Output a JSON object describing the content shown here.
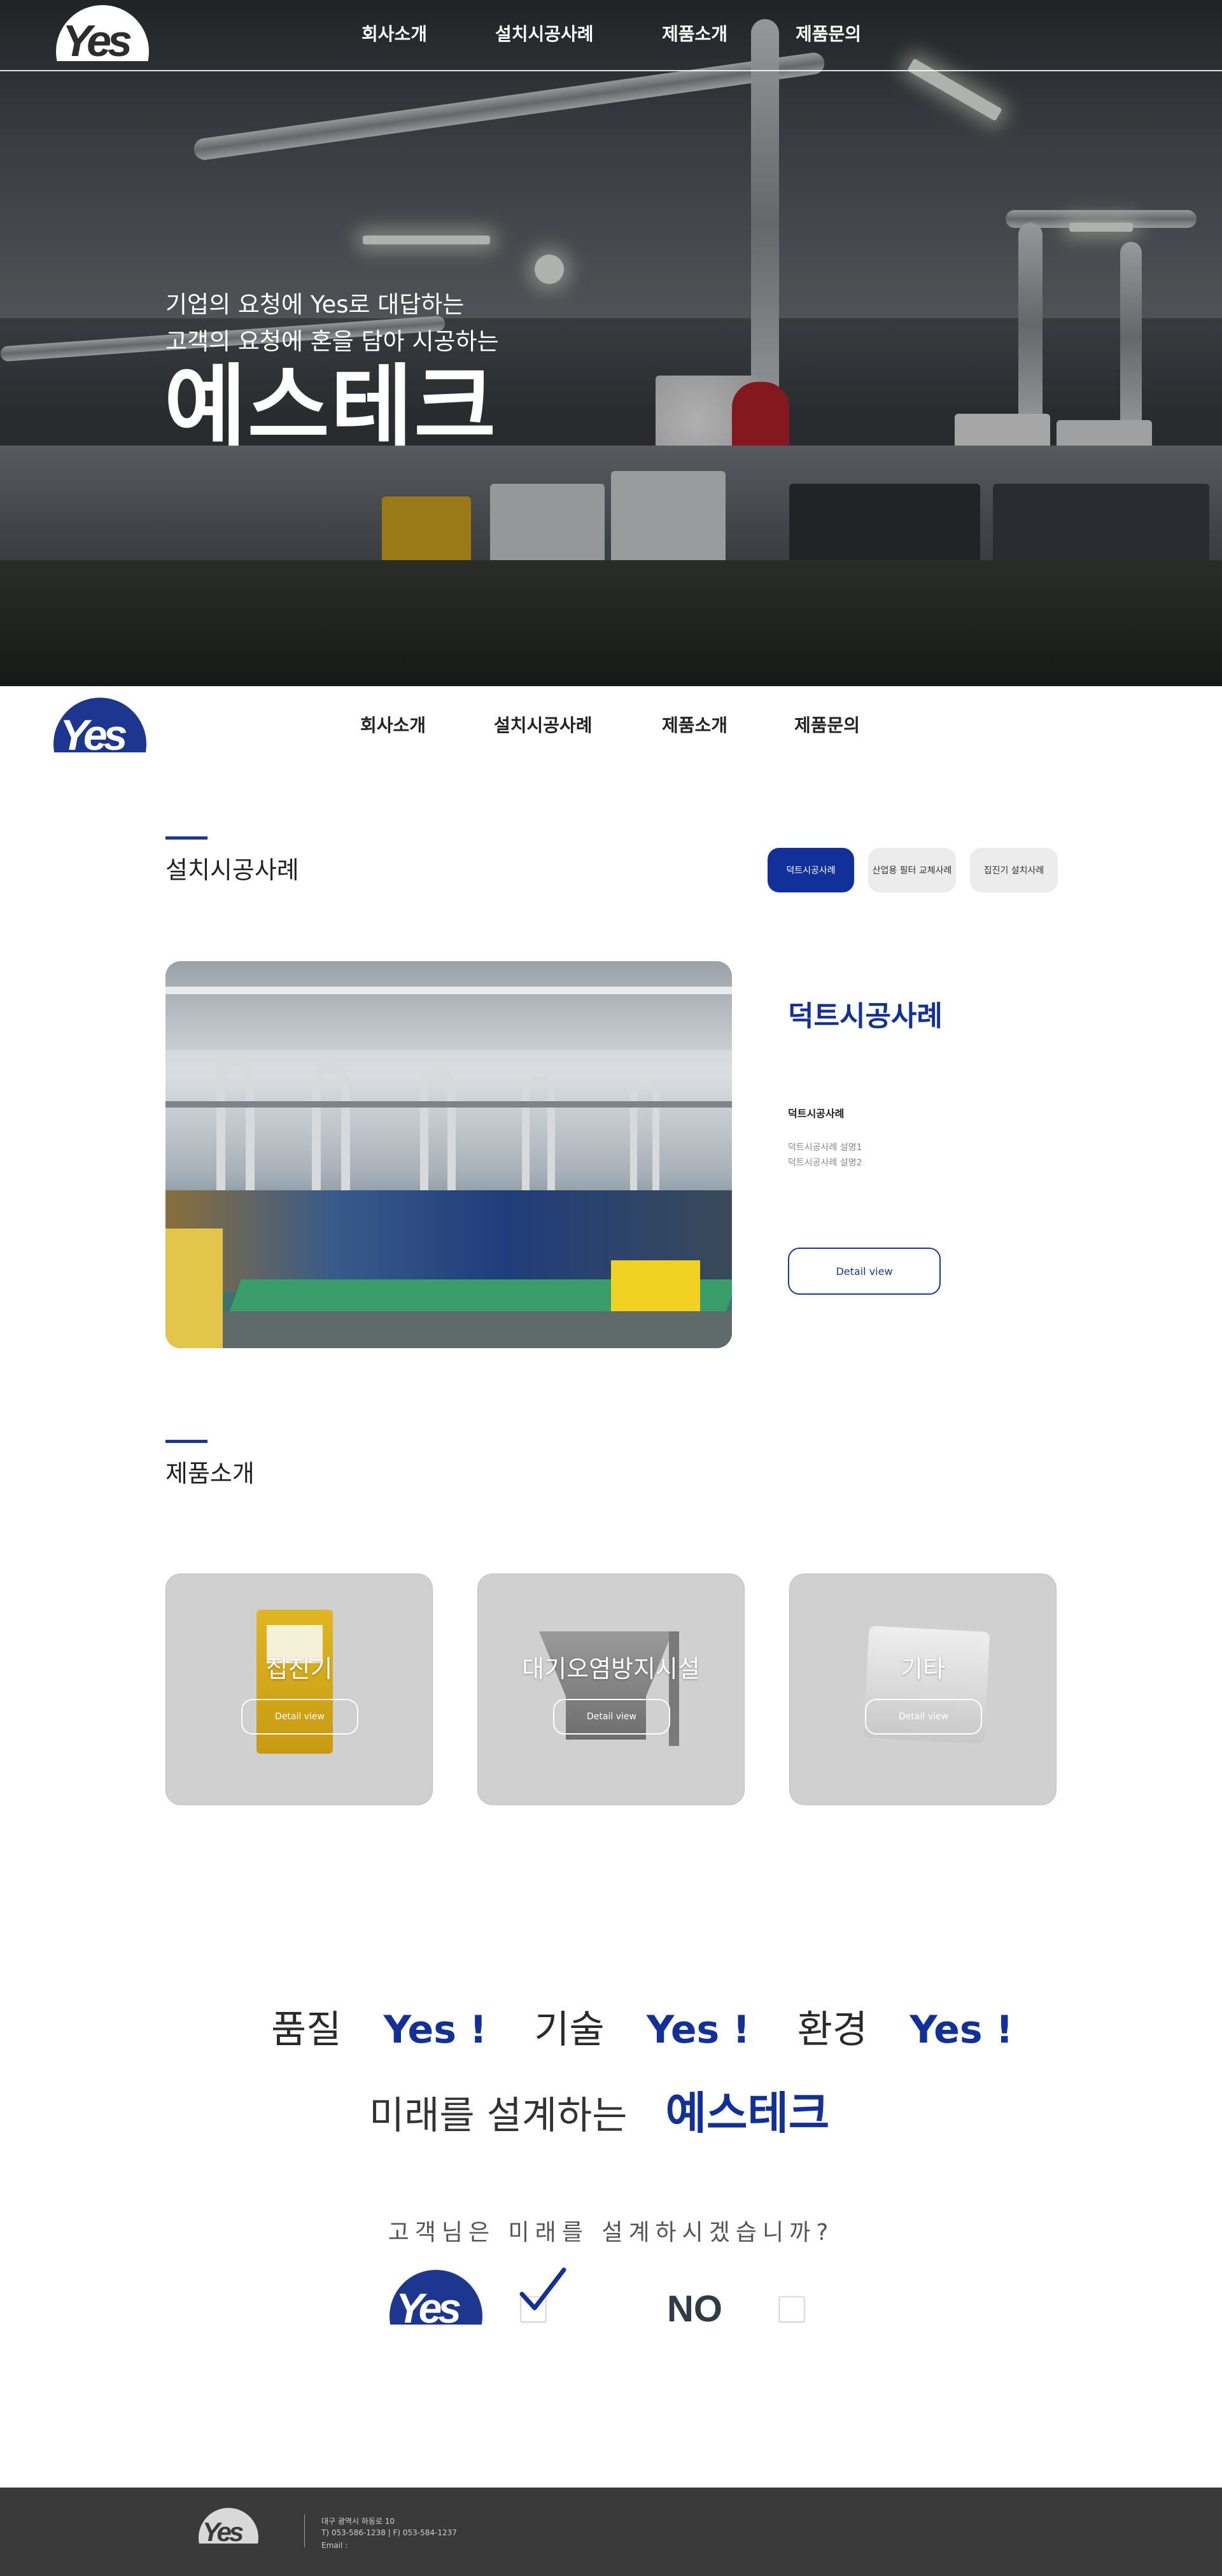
{
  "brand": {
    "logo_text": "Yes"
  },
  "nav": {
    "items": [
      "회사소개",
      "설치시공사례",
      "제품소개",
      "제품문의"
    ]
  },
  "hero": {
    "line1": "기업의 요청에 Yes로 대답하는",
    "line2": "고객의 요청에 혼을 담아 시공하는",
    "title": "예스테크"
  },
  "cases": {
    "section_title": "설치시공사례",
    "tabs": [
      "덕트시공사례",
      "산업용 필터 교체사례",
      "집진기 설치사례"
    ],
    "active_tab": 0,
    "title": "덕트시공사례",
    "subtitle": "덕트시공사례",
    "desc1": "덕트시공사례 설명1",
    "desc2": "덕트시공사례 설명2",
    "button": "Detail view"
  },
  "products": {
    "section_title": "제품소개",
    "items": [
      {
        "name": "집진기",
        "button": "Detail view"
      },
      {
        "name": "대기오염방지시설",
        "button": "Detail view"
      },
      {
        "name": "기타",
        "button": "Detail view"
      }
    ]
  },
  "slogan": {
    "w1": "품질",
    "y1": "Yes !",
    "w2": "기술",
    "y2": "Yes !",
    "w3": "환경",
    "y3": "Yes !",
    "line2_dark": "미래를 설계하는",
    "line2_blue": "예스테크",
    "question": "고객님은 미래를 설계하시겠습니까?",
    "no_label": "NO"
  },
  "footer": {
    "address": "대구 광역시 하동로 10",
    "phone": "T) 053-586-1238  |  F) 053-584-1237",
    "email": "Email :"
  },
  "colors": {
    "accent": "#12309a",
    "footer_bg": "#3a3a3a"
  }
}
